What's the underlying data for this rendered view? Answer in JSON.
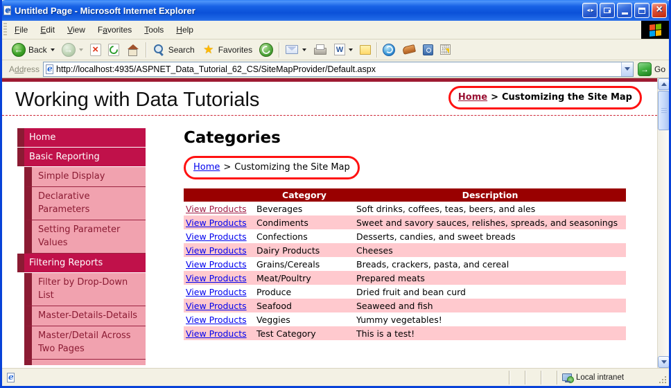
{
  "window": {
    "title": "Untitled Page - Microsoft Internet Explorer"
  },
  "menubar": {
    "items": [
      {
        "label": "File",
        "underline_index": 0
      },
      {
        "label": "Edit",
        "underline_index": 0
      },
      {
        "label": "View",
        "underline_index": 0
      },
      {
        "label": "Favorites",
        "underline_index": 1
      },
      {
        "label": "Tools",
        "underline_index": 0
      },
      {
        "label": "Help",
        "underline_index": 0
      }
    ]
  },
  "toolbar": {
    "buttons": [
      {
        "type": "button",
        "icon": "back-icon",
        "label": "Back",
        "dropdown": true
      },
      {
        "type": "button",
        "icon": "forward-icon",
        "dropdown": true,
        "disabled": true
      },
      {
        "type": "button",
        "icon": "stop-icon"
      },
      {
        "type": "button",
        "icon": "refresh-icon"
      },
      {
        "type": "button",
        "icon": "home-icon"
      },
      {
        "type": "separator"
      },
      {
        "type": "button",
        "icon": "search-icon",
        "label": "Search"
      },
      {
        "type": "button",
        "icon": "favorites-icon",
        "label": "Favorites"
      },
      {
        "type": "button",
        "icon": "history-icon"
      },
      {
        "type": "separator"
      },
      {
        "type": "button",
        "icon": "mail-icon",
        "dropdown": true
      },
      {
        "type": "button",
        "icon": "print-icon"
      },
      {
        "type": "button",
        "icon": "edit-word-icon",
        "dropdown": true
      },
      {
        "type": "button",
        "icon": "discuss-icon"
      },
      {
        "type": "separator"
      },
      {
        "type": "button",
        "icon": "messenger-icon"
      },
      {
        "type": "button",
        "icon": "addon-icon"
      },
      {
        "type": "button",
        "icon": "research-icon"
      },
      {
        "type": "button",
        "icon": "binary-addon-icon"
      }
    ]
  },
  "addressbar": {
    "label": "Address",
    "url": "http://localhost:4935/ASPNET_Data_Tutorial_62_CS/SiteMapProvider/Default.aspx",
    "go_label": "Go"
  },
  "page": {
    "site_title": "Working with Data Tutorials",
    "breadcrumb": {
      "home": "Home",
      "separator": ">",
      "current": "Customizing the Site Map"
    },
    "sidebar": {
      "items": [
        {
          "label": "Home",
          "level": 0
        },
        {
          "label": "Basic Reporting",
          "level": 0
        },
        {
          "label": "Simple Display",
          "level": 1
        },
        {
          "label": "Declarative Parameters",
          "level": 1
        },
        {
          "label": "Setting Parameter Values",
          "level": 1
        },
        {
          "label": "Filtering Reports",
          "level": 0
        },
        {
          "label": "Filter by Drop-Down List",
          "level": 1
        },
        {
          "label": "Master-Details-Details",
          "level": 1
        },
        {
          "label": "Master/Detail Across Two Pages",
          "level": 1
        },
        {
          "label": "",
          "level": 1,
          "partial": true
        }
      ]
    },
    "main": {
      "heading": "Categories",
      "table": {
        "headers": [
          "",
          "Category",
          "Description"
        ],
        "link_label": "View Products",
        "rows": [
          {
            "category": "Beverages",
            "description": "Soft drinks, coffees, teas, beers, and ales",
            "link_visited": true
          },
          {
            "category": "Condiments",
            "description": "Sweet and savory sauces, relishes, spreads, and seasonings"
          },
          {
            "category": "Confections",
            "description": "Desserts, candies, and sweet breads"
          },
          {
            "category": "Dairy Products",
            "description": "Cheeses"
          },
          {
            "category": "Grains/Cereals",
            "description": "Breads, crackers, pasta, and cereal"
          },
          {
            "category": "Meat/Poultry",
            "description": "Prepared meats"
          },
          {
            "category": "Produce",
            "description": "Dried fruit and bean curd"
          },
          {
            "category": "Seafood",
            "description": "Seaweed and fish"
          },
          {
            "category": "Veggies",
            "description": "Yummy vegetables!"
          },
          {
            "category": "Test Category",
            "description": "This is a test!"
          }
        ]
      }
    }
  },
  "statusbar": {
    "zone_label": "Local intranet"
  },
  "colors": {
    "crimson": "#C0114A",
    "maroon": "#8B1B33",
    "subitem_pink": "#F1A2AF",
    "row_pink": "#FFC9CE",
    "header_red": "#990000",
    "band_red": "#9E1B32",
    "dash_red": "#CC2233",
    "link_blue": "#0000EE",
    "link_visited": "#A01C45",
    "annotation_red": "#FF1111",
    "breadcrumb_maroon": "#991133"
  }
}
